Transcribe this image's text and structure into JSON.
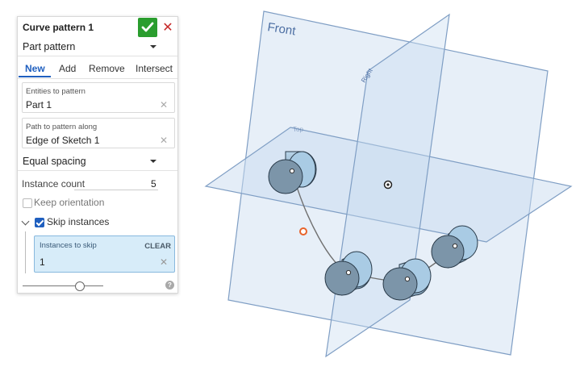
{
  "panel": {
    "title": "Curve pattern 1",
    "pattern_type": "Part pattern",
    "tabs": [
      {
        "label": "New",
        "active": true
      },
      {
        "label": "Add"
      },
      {
        "label": "Remove"
      },
      {
        "label": "Intersect"
      }
    ],
    "entities_field": {
      "label": "Entities to pattern",
      "value": "Part 1"
    },
    "path_field": {
      "label": "Path to pattern along",
      "value": "Edge of Sketch 1"
    },
    "spacing": "Equal spacing",
    "instance_count": {
      "label": "Instance count",
      "value": "5"
    },
    "keep_orientation": {
      "label": "Keep orientation",
      "checked": false
    },
    "skip_instances": {
      "label": "Skip instances",
      "checked": true
    },
    "skip_field": {
      "label": "Instances to skip",
      "clear_label": "CLEAR",
      "value": "1"
    },
    "close_glyph": "✕",
    "help_glyph": "?"
  },
  "viewport": {
    "plane_labels": {
      "front": "Front",
      "right": "Right",
      "top": "Top"
    }
  },
  "colors": {
    "accent": "#1f5fbf",
    "confirm": "#2a9d2e",
    "cancel": "#c62828",
    "plane_fill": "#c9dbef",
    "plane_edge": "#7f9ec4",
    "cylinder": "#88a8c0",
    "origin_marker": "#e8632a"
  }
}
